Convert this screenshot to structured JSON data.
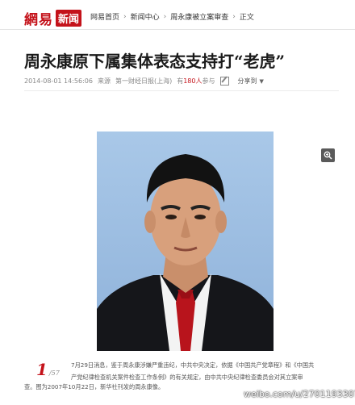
{
  "header": {
    "logo_main": "網易",
    "logo_badge": "新闻",
    "breadcrumbs": [
      "网易首页",
      "新闻中心",
      "周永康被立案审查",
      "正文"
    ],
    "separator": "›"
  },
  "article": {
    "title": "周永康原下属集体表态支持打“老虎”",
    "datetime": "2014-08-01 14:56:06",
    "source_label": "来源",
    "source": "第一财经日报(上海)",
    "participants_prefix": "有",
    "participants_count": "180人",
    "participants_suffix": "参与",
    "share_label": "分享到"
  },
  "gallery": {
    "current": "1",
    "total": "/57",
    "zoom_icon": "zoom-in-icon",
    "caption_line1": "7月29日消息，鉴于周永康涉嫌严重违纪，中共中央决定，依据《中国共产党章程》和《中国共",
    "caption_line2": "产党纪律检查机关案件检查工作条例》的有关规定，由中共中央纪律检查委员会对其立案审",
    "caption_line3": "查。图为2007年10月22日，新华社刊发的周永康像。"
  },
  "watermark": "weibo.com/u/2701193307",
  "colors": {
    "brand_red": "#c4121a",
    "photo_bg": "#9dbde2"
  }
}
